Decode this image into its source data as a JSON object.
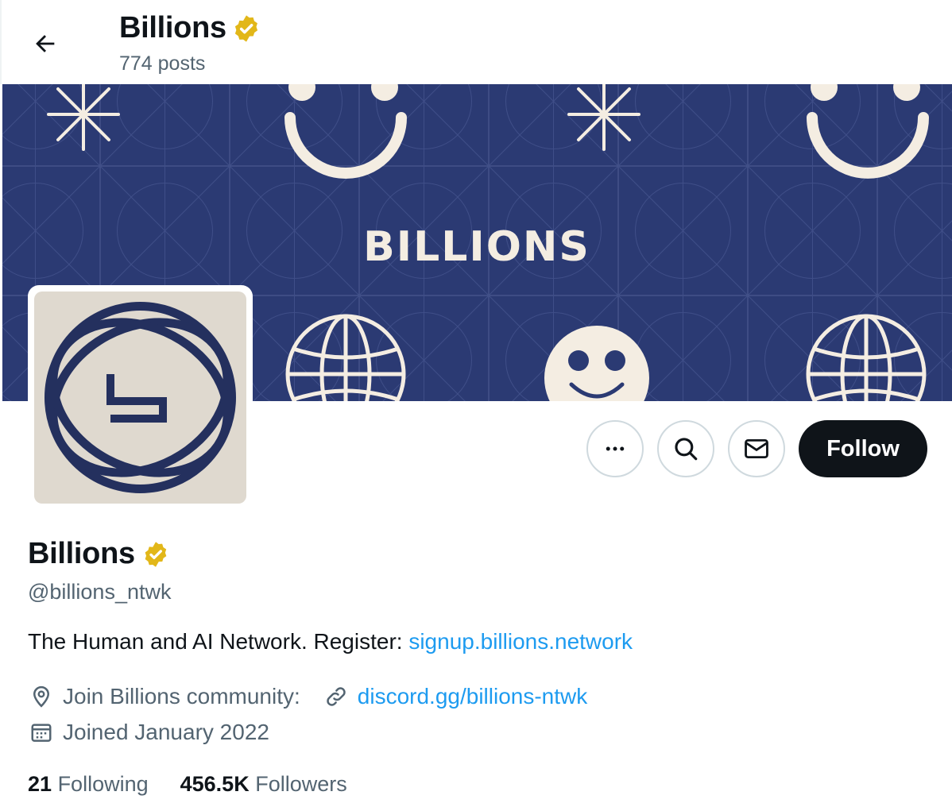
{
  "header": {
    "title": "Billions",
    "posts": "774 posts"
  },
  "banner": {
    "wordmark": "BILLIONS",
    "background": "#2b3a73"
  },
  "avatar": {
    "glyph": "b",
    "background": "#dfd9cf",
    "foreground": "#24305e"
  },
  "actions": {
    "more_icon": "more-icon",
    "search_icon": "search-icon",
    "message_icon": "mail-icon",
    "follow_label": "Follow"
  },
  "profile": {
    "name": "Billions",
    "verified_color": "#e2b719",
    "handle": "@billions_ntwk",
    "bio_text": "The Human and AI Network. Register: ",
    "bio_link": "signup.billions.network",
    "location": "Join Billions community:",
    "website": "discord.gg/billions-ntwk",
    "joined": "Joined January 2022"
  },
  "stats": {
    "following_count": "21",
    "following_label": "Following",
    "followers_count": "456.5K",
    "followers_label": "Followers"
  },
  "colors": {
    "link": "#1d9bf0",
    "muted": "#536471",
    "text": "#0f1419"
  }
}
